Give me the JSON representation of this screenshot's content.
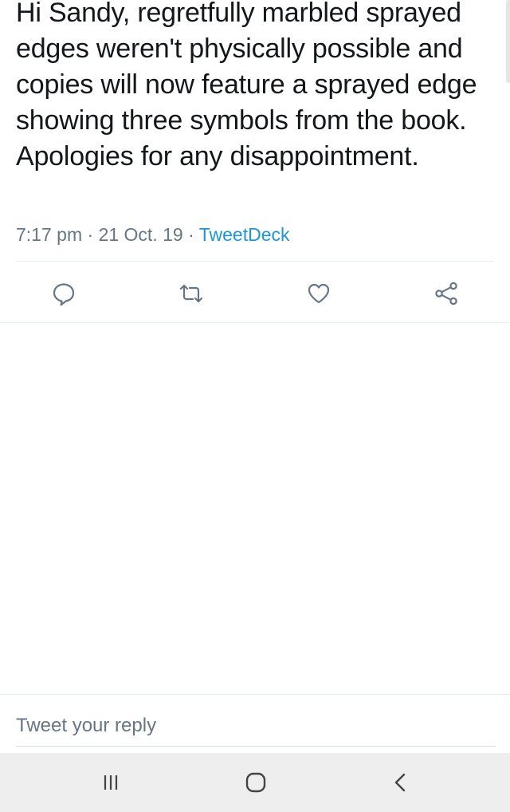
{
  "tweet": {
    "text": "Hi Sandy, regretfully marbled sprayed edges weren't physically possible and copies will now feature a sprayed edge showing three symbols from the book. Apologies for any disappointment.",
    "time": "7:17 pm",
    "separator": "·",
    "date": "21 Oct. 19",
    "source": "TweetDeck"
  },
  "actions": [
    {
      "name": "reply",
      "icon": "reply-icon"
    },
    {
      "name": "retweet",
      "icon": "retweet-icon"
    },
    {
      "name": "like",
      "icon": "heart-icon"
    },
    {
      "name": "share",
      "icon": "share-icon"
    }
  ],
  "reply_bar": {
    "placeholder": "Tweet your reply"
  },
  "system_nav": {
    "recent_apps": "recent-apps-icon",
    "home": "home-icon",
    "back": "back-icon"
  },
  "colors": {
    "text": "#14171a",
    "secondary": "#657786",
    "link": "#1b95e0",
    "divider": "#e6ecf0",
    "navbar": "#eeeeee"
  }
}
